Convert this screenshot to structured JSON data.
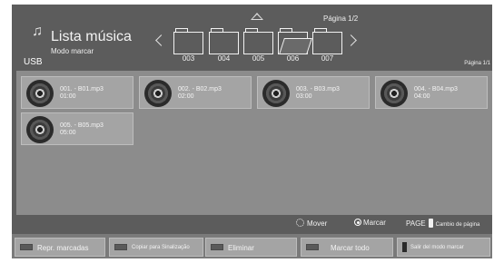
{
  "header": {
    "title": "Lista música",
    "mode": "Modo marcar",
    "source": "USB",
    "page_top": "Página 1/2",
    "page_right": "Página 1/1"
  },
  "icons": {
    "title_icon": "music-note-icon",
    "nav_up": "arrow-up-icon",
    "nav_left": "chevron-left-icon",
    "nav_right": "chevron-right-icon",
    "folder": "folder-icon",
    "track": "disc-icon"
  },
  "folders": [
    {
      "label": "",
      "open": false
    },
    {
      "label": "003",
      "open": false
    },
    {
      "label": "004",
      "open": false
    },
    {
      "label": "005",
      "open": true
    },
    {
      "label": "006",
      "open": false
    },
    {
      "label": "007",
      "open": false
    }
  ],
  "tracks": [
    {
      "title": "001. - B01.mp3",
      "duration": "01:00"
    },
    {
      "title": "002. - B02.mp3",
      "duration": "02:00"
    },
    {
      "title": "003. - B03.mp3",
      "duration": "03:00"
    },
    {
      "title": "004. - B04.mp3",
      "duration": "04:00"
    },
    {
      "title": "005. - B05.mp3",
      "duration": "05:00"
    }
  ],
  "hints": {
    "move": "Mover",
    "mark": "Marcar",
    "page": "PAGE",
    "page_change": "Cambio de página"
  },
  "buttons": {
    "play_marked": "Repr. marcadas",
    "copy": "Copiar para Sinalização",
    "delete": "Eliminar",
    "mark_all": "Marcar todo",
    "exit_mark": "Salir del modo marcar"
  },
  "colors": {
    "background": "#5c5c5c",
    "panel": "#8c8c8c",
    "tile": "#a4a4a4"
  }
}
